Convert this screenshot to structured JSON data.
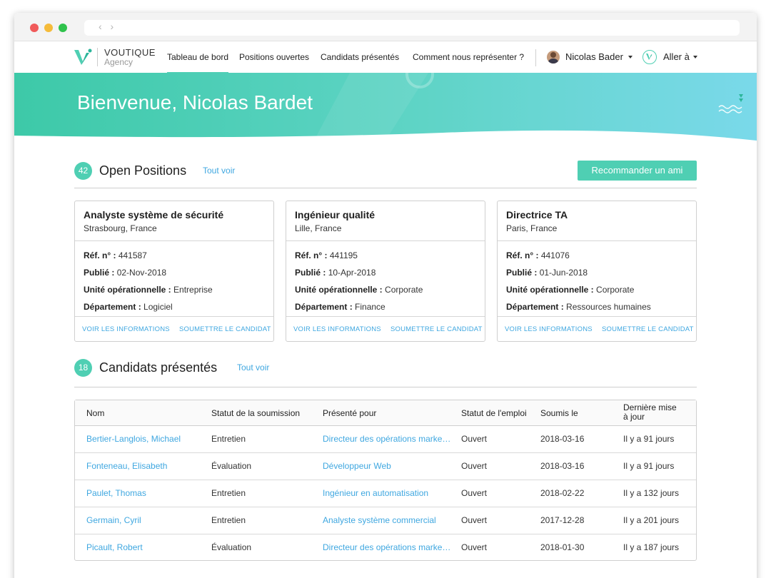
{
  "browser": {
    "nav_arrows": "‹ ›"
  },
  "nav": {
    "brand": "VOUTIQUE",
    "brand_sub": "Agency",
    "links": [
      "Tableau de bord",
      "Positions ouvertes",
      "Candidats présentés",
      "Comment nous représenter ?"
    ],
    "active_index": 0,
    "user_name": "Nicolas Bader",
    "goto_label": "Aller à"
  },
  "hero": {
    "title": "Bienvenue, Nicolas Bardet"
  },
  "open_positions": {
    "count": "42",
    "title": "Open Positions",
    "see_all": "Tout voir",
    "recommend_button": "Recommander un ami",
    "cards": [
      {
        "title": "Analyste système de sécurité",
        "location": "Strasbourg, France",
        "ref_label": "Réf. n° :",
        "ref": "441587",
        "published_label": "Publié :",
        "published": "02-Nov-2018",
        "unit_label": "Unité opérationnelle :",
        "unit": "Entreprise",
        "dept_label": "Département :",
        "dept": "Logiciel",
        "view_link": "VOIR LES INFORMATIONS",
        "submit_link": "SOUMETTRE LE CANDIDAT"
      },
      {
        "title": "Ingénieur qualité",
        "location": "Lille, France",
        "ref_label": "Réf. n° :",
        "ref": "441195",
        "published_label": "Publié :",
        "published": "10-Apr-2018",
        "unit_label": "Unité opérationnelle :",
        "unit": "Corporate",
        "dept_label": "Département :",
        "dept": "Finance",
        "view_link": "VOIR LES INFORMATIONS",
        "submit_link": "SOUMETTRE LE CANDIDAT"
      },
      {
        "title": "Directrice TA",
        "location": "Paris, France",
        "ref_label": "Réf. n° :",
        "ref": "441076",
        "published_label": "Publié :",
        "published": "01-Jun-2018",
        "unit_label": "Unité opérationnelle :",
        "unit": "Corporate",
        "dept_label": "Département :",
        "dept": "Ressources humaines",
        "view_link": "VOIR LES INFORMATIONS",
        "submit_link": "SOUMETTRE LE CANDIDAT"
      }
    ]
  },
  "candidates": {
    "count": "18",
    "title": "Candidats présentés",
    "see_all": "Tout voir",
    "columns": {
      "name": "Nom",
      "status": "Statut de la soumission",
      "presented_for": "Présenté pour",
      "job_status": "Statut de l'emploi",
      "submitted": "Soumis le",
      "updated_line1": "Dernière mise",
      "updated_line2": "à jour"
    },
    "rows": [
      {
        "name": "Bertier-Langlois, Michael",
        "status": "Entretien",
        "position": "Directeur des opérations marketing",
        "job_status": "Ouvert",
        "submitted": "2018-03-16",
        "updated": "Il y a 91 jours"
      },
      {
        "name": "Fonteneau, Elisabeth",
        "status": "Évaluation",
        "position": "Développeur Web",
        "job_status": "Ouvert",
        "submitted": "2018-03-16",
        "updated": "Il y a 91 jours"
      },
      {
        "name": "Paulet, Thomas",
        "status": "Entretien",
        "position": "Ingénieur en automatisation",
        "job_status": "Ouvert",
        "submitted": "2018-02-22",
        "updated": "Il y a 132 jours"
      },
      {
        "name": "Germain, Cyril",
        "status": "Entretien",
        "position": "Analyste système commercial",
        "job_status": "Ouvert",
        "submitted": "2017-12-28",
        "updated": "Il y a 201 jours"
      },
      {
        "name": "Picault, Robert",
        "status": "Évaluation",
        "position": "Directeur des opérations marketing",
        "job_status": "Ouvert",
        "submitted": "2018-01-30",
        "updated": "Il y a 187 jours"
      }
    ]
  },
  "colors": {
    "accent": "#4fcfb3",
    "link": "#3fa7e0"
  }
}
